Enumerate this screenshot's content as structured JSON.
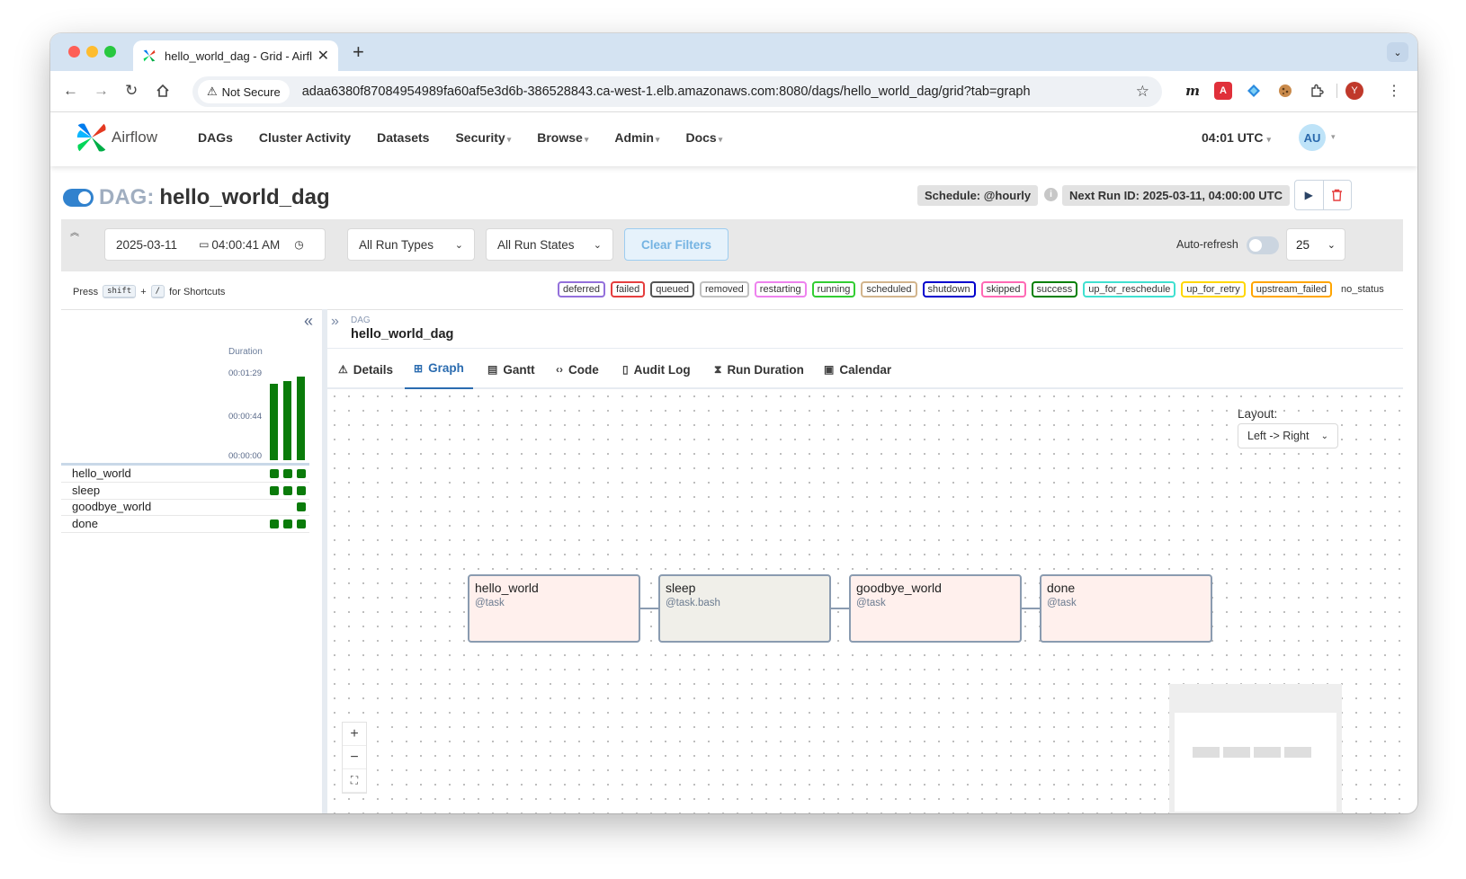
{
  "browser": {
    "tab_title": "hello_world_dag - Grid - Airfl",
    "not_secure": "Not Secure",
    "url": "adaa6380f87084954989fa60af5e3d6b-386528843.ca-west-1.elb.amazonaws.com:8080/dags/hello_world_dag/grid?tab=graph",
    "profile_initial": "Y"
  },
  "nav": {
    "logo_text": "Airflow",
    "items": [
      "DAGs",
      "Cluster Activity",
      "Datasets",
      "Security",
      "Browse",
      "Admin",
      "Docs"
    ],
    "time": "04:01 UTC",
    "user_initials": "AU"
  },
  "dag": {
    "prefix": "DAG:",
    "name": "hello_world_dag",
    "schedule": "Schedule: @hourly",
    "next_run": "Next Run ID: 2025-03-11, 04:00:00 UTC"
  },
  "filters": {
    "date": "2025-03-11",
    "time": "04:00:41 AM",
    "run_types": "All Run Types",
    "run_states": "All Run States",
    "clear": "Clear Filters",
    "auto_refresh": "Auto-refresh",
    "page_size": "25"
  },
  "shortcuts": {
    "press": "Press",
    "key1": "shift",
    "plus": "+",
    "key2": "/",
    "suffix": "for Shortcuts"
  },
  "legend": [
    {
      "label": "deferred",
      "color": "#9370db"
    },
    {
      "label": "failed",
      "color": "#e53e3e"
    },
    {
      "label": "queued",
      "color": "#555555"
    },
    {
      "label": "removed",
      "color": "#c0c0c0"
    },
    {
      "label": "restarting",
      "color": "#ee82ee"
    },
    {
      "label": "running",
      "color": "#32cd32"
    },
    {
      "label": "scheduled",
      "color": "#d2b48c"
    },
    {
      "label": "shutdown",
      "color": "#0000cd"
    },
    {
      "label": "skipped",
      "color": "#ff69b4"
    },
    {
      "label": "success",
      "color": "#008000"
    },
    {
      "label": "up_for_reschedule",
      "color": "#40e0d0"
    },
    {
      "label": "up_for_retry",
      "color": "#ffd700"
    },
    {
      "label": "upstream_failed",
      "color": "#ffa500"
    }
  ],
  "legend_no_status": "no_status",
  "grid": {
    "duration_title": "Duration",
    "duration_ticks": [
      "00:01:29",
      "00:00:44",
      "00:00:00"
    ],
    "run_durations": [
      0.88,
      0.91,
      0.96
    ],
    "tasks": [
      {
        "name": "hello_world",
        "runs": 3
      },
      {
        "name": "sleep",
        "runs": 3
      },
      {
        "name": "goodbye_world",
        "runs": 1
      },
      {
        "name": "done",
        "runs": 3
      }
    ]
  },
  "details": {
    "breadcrumb_label": "DAG",
    "breadcrumb_name": "hello_world_dag",
    "tabs": [
      "Details",
      "Graph",
      "Gantt",
      "Code",
      "Audit Log",
      "Run Duration",
      "Calendar"
    ],
    "active_tab": "Graph"
  },
  "graph": {
    "layout_label": "Layout:",
    "layout_value": "Left -> Right",
    "nodes": [
      {
        "name": "hello_world",
        "type": "@task",
        "fill": "#fff0ed"
      },
      {
        "name": "sleep",
        "type": "@task.bash",
        "fill": "#f0efe9"
      },
      {
        "name": "goodbye_world",
        "type": "@task",
        "fill": "#fff0ed"
      },
      {
        "name": "done",
        "type": "@task",
        "fill": "#fff0ed"
      }
    ]
  }
}
